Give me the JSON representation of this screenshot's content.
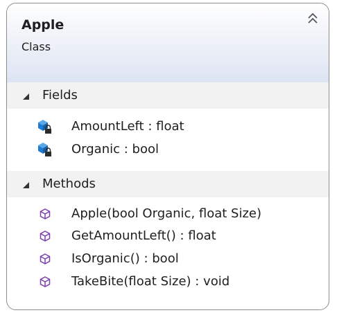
{
  "class": {
    "name": "Apple",
    "stereotype": "Class"
  },
  "sections": {
    "fields": {
      "label": "Fields",
      "items": [
        {
          "text": "AmountLeft : float",
          "icon": "private-field-icon"
        },
        {
          "text": "Organic : bool",
          "icon": "private-field-icon"
        }
      ]
    },
    "methods": {
      "label": "Methods",
      "items": [
        {
          "text": "Apple(bool Organic, float Size)",
          "icon": "method-icon"
        },
        {
          "text": "GetAmountLeft() : float",
          "icon": "method-icon"
        },
        {
          "text": "IsOrganic() : bool",
          "icon": "method-icon"
        },
        {
          "text": "TakeBite(float Size) : void",
          "icon": "method-icon"
        }
      ]
    }
  },
  "colors": {
    "field_icon": "#1e7bd2",
    "method_icon": "#7d3fb0",
    "header_gradient_end": "#dde4f2"
  }
}
